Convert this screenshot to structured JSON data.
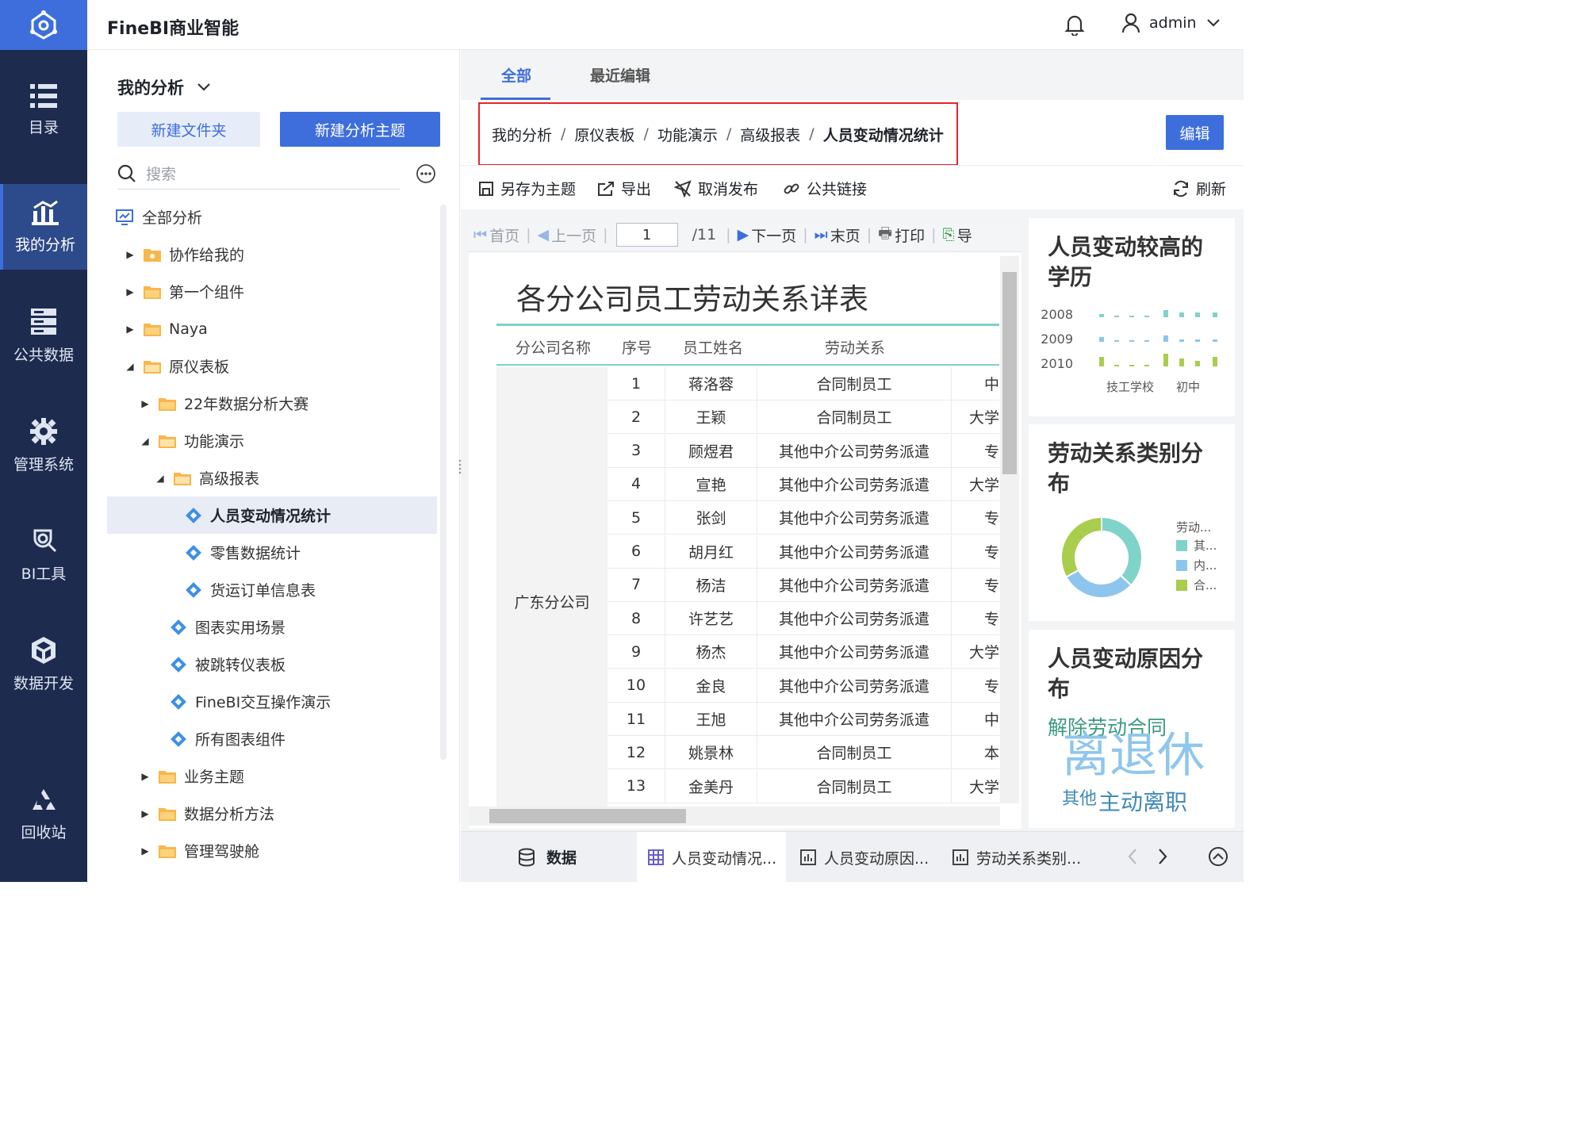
{
  "app": {
    "title": "FineBI商业智能",
    "user": "admin"
  },
  "rail": [
    {
      "label": "目录",
      "icon": "list-icon"
    },
    {
      "label": "我的分析",
      "icon": "analysis-icon"
    },
    {
      "label": "公共数据",
      "icon": "database-icon"
    },
    {
      "label": "管理系统",
      "icon": "gear-icon"
    },
    {
      "label": "BI工具",
      "icon": "tools-icon"
    },
    {
      "label": "数据开发",
      "icon": "cube-icon"
    },
    {
      "label": "回收站",
      "icon": "recycle-icon"
    }
  ],
  "tree": {
    "title": "我的分析",
    "new_folder": "新建文件夹",
    "new_subject": "新建分析主题",
    "search_placeholder": "搜索",
    "nodes": [
      {
        "label": "全部分析"
      },
      {
        "label": "协作给我的"
      },
      {
        "label": "第一个组件"
      },
      {
        "label": "Naya"
      },
      {
        "label": "原仪表板"
      },
      {
        "label": "22年数据分析大赛"
      },
      {
        "label": "功能演示"
      },
      {
        "label": "高级报表"
      },
      {
        "label": "人员变动情况统计"
      },
      {
        "label": "零售数据统计"
      },
      {
        "label": "货运订单信息表"
      },
      {
        "label": "图表实用场景"
      },
      {
        "label": "被跳转仪表板"
      },
      {
        "label": "FineBI交互操作演示"
      },
      {
        "label": "所有图表组件"
      },
      {
        "label": "业务主题"
      },
      {
        "label": "数据分析方法"
      },
      {
        "label": "管理驾驶舱"
      }
    ]
  },
  "tabs": {
    "all": "全部",
    "recent": "最近编辑"
  },
  "breadcrumb": [
    "我的分析",
    "原仪表板",
    "功能演示",
    "高级报表",
    "人员变动情况统计"
  ],
  "breadcrumb_sep": "/",
  "edit_label": "编辑",
  "toolbar": {
    "save_as": "另存为主题",
    "export": "导出",
    "unpublish": "取消发布",
    "public_link": "公共链接",
    "refresh": "刷新"
  },
  "pager": {
    "first": "首页",
    "prev": "上一页",
    "page": "1",
    "total": "/11",
    "next": "下一页",
    "last": "末页",
    "print": "打印",
    "export": "导"
  },
  "report": {
    "title": "各分公司员工劳动关系详表",
    "headers": [
      "分公司名称",
      "序号",
      "员工姓名",
      "劳动关系"
    ],
    "company": "广东分公司",
    "rows": [
      {
        "no": "1",
        "name": "蒋洛蓉",
        "rel": "合同制员工",
        "extra": "中"
      },
      {
        "no": "2",
        "name": "王颖",
        "rel": "合同制员工",
        "extra": "大学"
      },
      {
        "no": "3",
        "name": "顾煜君",
        "rel": "其他中介公司劳务派遣",
        "extra": "专"
      },
      {
        "no": "4",
        "name": "宣艳",
        "rel": "其他中介公司劳务派遣",
        "extra": "大学"
      },
      {
        "no": "5",
        "name": "张剑",
        "rel": "其他中介公司劳务派遣",
        "extra": "专"
      },
      {
        "no": "6",
        "name": "胡月红",
        "rel": "其他中介公司劳务派遣",
        "extra": "专"
      },
      {
        "no": "7",
        "name": "杨洁",
        "rel": "其他中介公司劳务派遣",
        "extra": "专"
      },
      {
        "no": "8",
        "name": "许艺艺",
        "rel": "其他中介公司劳务派遣",
        "extra": "专"
      },
      {
        "no": "9",
        "name": "杨杰",
        "rel": "其他中介公司劳务派遣",
        "extra": "大学"
      },
      {
        "no": "10",
        "name": "金良",
        "rel": "其他中介公司劳务派遣",
        "extra": "专"
      },
      {
        "no": "11",
        "name": "王旭",
        "rel": "其他中介公司劳务派遣",
        "extra": "中"
      },
      {
        "no": "12",
        "name": "姚景林",
        "rel": "合同制员工",
        "extra": "本"
      },
      {
        "no": "13",
        "name": "金美丹",
        "rel": "合同制员工",
        "extra": "大学"
      }
    ]
  },
  "widgets": [
    {
      "title": "人员变动较高的学历"
    },
    {
      "title": "劳动关系类别分布"
    },
    {
      "title": "人员变动原因分布"
    }
  ],
  "chart_data": [
    {
      "type": "scatter",
      "title": "人员变动较高的学历",
      "y_categories": [
        "2008",
        "2009",
        "2010"
      ],
      "x_categories": [
        "技工学校",
        "初中"
      ]
    },
    {
      "type": "pie",
      "title": "劳动关系类别分布",
      "legend_title": "劳动...",
      "slices": [
        {
          "label": "其...",
          "value": 37,
          "color": "#7fd3c8"
        },
        {
          "label": "内...",
          "value": 30,
          "color": "#8ec5ee"
        },
        {
          "label": "合...",
          "value": 33,
          "color": "#a9cd4c"
        }
      ]
    },
    {
      "type": "wordcloud",
      "title": "人员变动原因分布",
      "words": [
        {
          "text": "解除劳动合同",
          "color": "#3a9a7e"
        },
        {
          "text": "离退休",
          "color": "#8fc6ee"
        },
        {
          "text": "其他",
          "color": "#3f8ab8"
        },
        {
          "text": "主动离职",
          "color": "#3f8ab8"
        }
      ]
    }
  ],
  "bottom": {
    "data": "数据",
    "tabs": [
      {
        "label": "人员变动情况..."
      },
      {
        "label": "人员变动原因..."
      },
      {
        "label": "劳动关系类别..."
      }
    ]
  },
  "colors": {
    "accent": "#3d6edb",
    "rail_bg": "#1d2b4f",
    "highlight": "#e5252f",
    "report_line": "#7fd0c8"
  }
}
